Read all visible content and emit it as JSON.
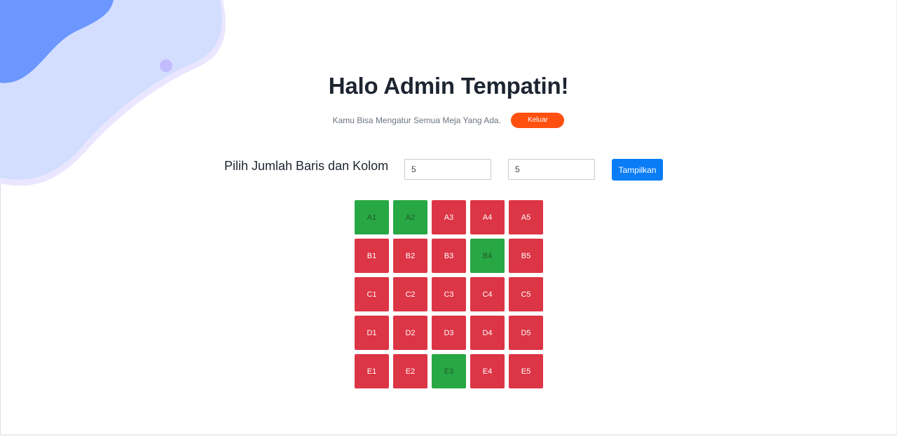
{
  "header": {
    "title": "Halo Admin Tempatin!",
    "subtitle": "Kamu Bisa Mengatur Semua Meja Yang Ada.",
    "logout_label": "Keluar"
  },
  "selector": {
    "label": "Pilih Jumlah Baris dan Kolom",
    "rows_value": "5",
    "cols_value": "5",
    "submit_label": "Tampilkan"
  },
  "colors": {
    "occupied": "#dc3545",
    "available": "#28a745",
    "logout": "#ff5010",
    "primary": "#0a7cf5"
  },
  "seats": [
    {
      "label": "A1",
      "status": "available"
    },
    {
      "label": "A2",
      "status": "available"
    },
    {
      "label": "A3",
      "status": "occupied"
    },
    {
      "label": "A4",
      "status": "occupied"
    },
    {
      "label": "A5",
      "status": "occupied"
    },
    {
      "label": "B1",
      "status": "occupied"
    },
    {
      "label": "B2",
      "status": "occupied"
    },
    {
      "label": "B3",
      "status": "occupied"
    },
    {
      "label": "B4",
      "status": "available"
    },
    {
      "label": "B5",
      "status": "occupied"
    },
    {
      "label": "C1",
      "status": "occupied"
    },
    {
      "label": "C2",
      "status": "occupied"
    },
    {
      "label": "C3",
      "status": "occupied"
    },
    {
      "label": "C4",
      "status": "occupied"
    },
    {
      "label": "C5",
      "status": "occupied"
    },
    {
      "label": "D1",
      "status": "occupied"
    },
    {
      "label": "D2",
      "status": "occupied"
    },
    {
      "label": "D3",
      "status": "occupied"
    },
    {
      "label": "D4",
      "status": "occupied"
    },
    {
      "label": "D5",
      "status": "occupied"
    },
    {
      "label": "E1",
      "status": "occupied"
    },
    {
      "label": "E2",
      "status": "occupied"
    },
    {
      "label": "E3",
      "status": "available"
    },
    {
      "label": "E4",
      "status": "occupied"
    },
    {
      "label": "E5",
      "status": "occupied"
    }
  ]
}
